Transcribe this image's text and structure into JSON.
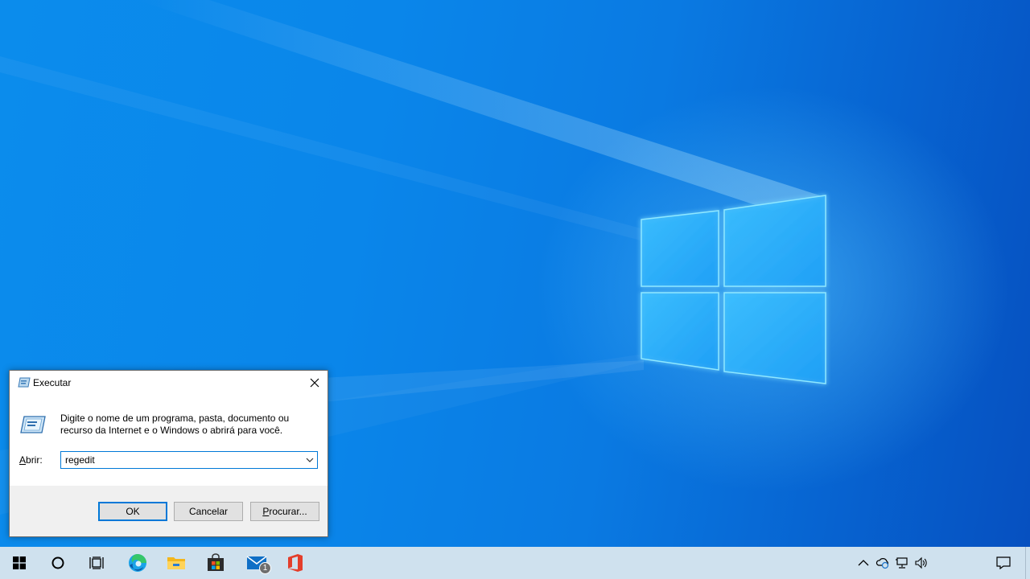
{
  "dialog": {
    "title": "Executar",
    "description": "Digite o nome de um programa, pasta, documento ou recurso da Internet e o Windows o abrirá para você.",
    "open_label_mnemonic": "A",
    "open_label_rest": "brir:",
    "open_value": "regedit",
    "ok_label": "OK",
    "cancel_label": "Cancelar",
    "browse_mnemonic": "P",
    "browse_rest": "rocurar..."
  },
  "taskbar": {
    "pinned": [
      "start-icon",
      "search-icon",
      "task-view-icon",
      "edge-icon",
      "file-explorer-icon",
      "store-icon",
      "mail-icon",
      "office-icon"
    ],
    "mail_badge": "1",
    "tray": [
      "chevron-up-icon",
      "onedrive-sync-icon",
      "network-icon",
      "volume-icon",
      "notification-icon"
    ]
  },
  "colors": {
    "accent": "#0078d7",
    "taskbar": "#cfe1ee",
    "desktop": "#0a78e0"
  }
}
